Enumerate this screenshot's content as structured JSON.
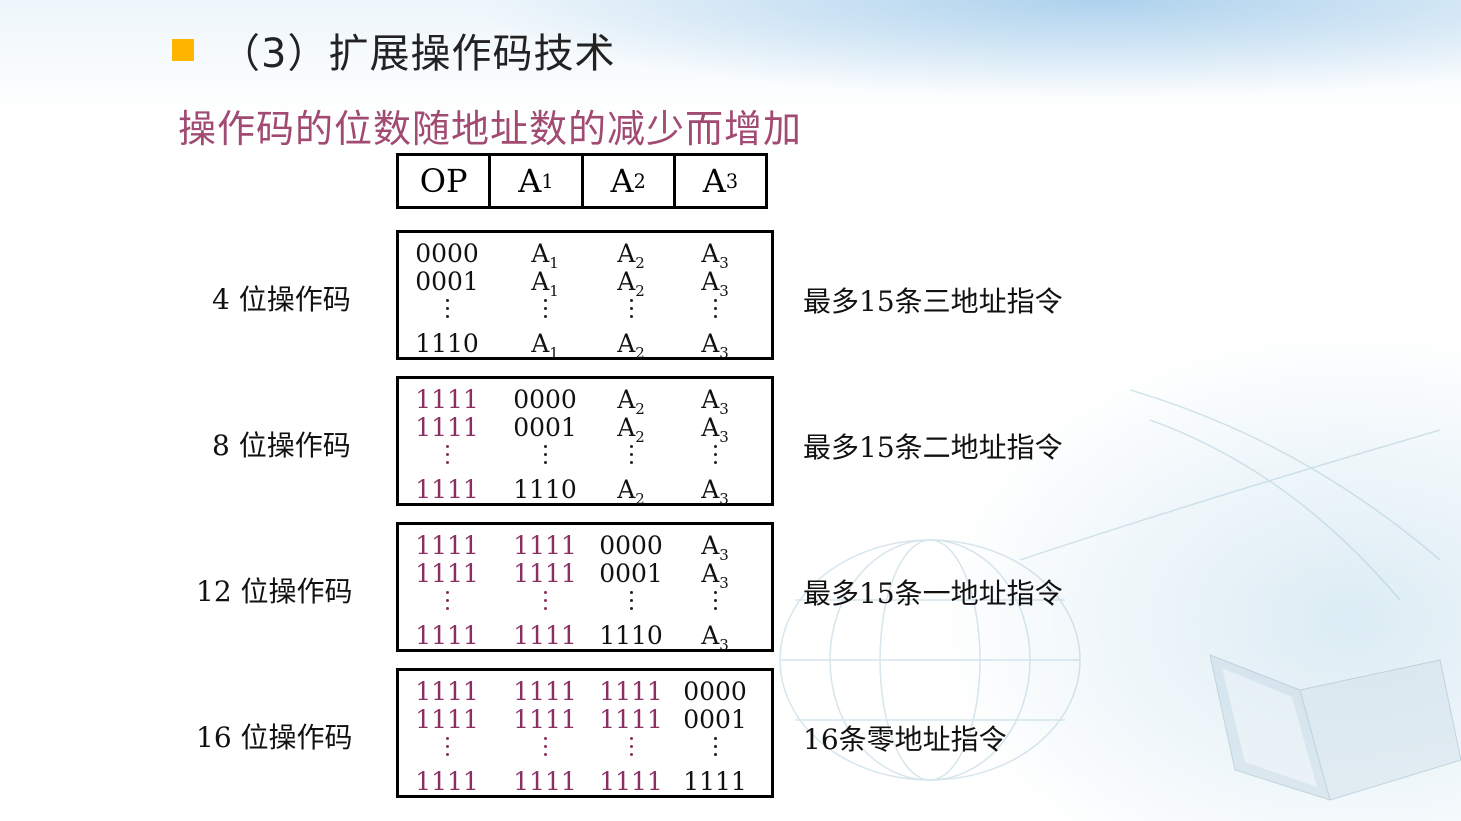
{
  "slide": {
    "title": "（3）扩展操作码技术",
    "subtitle": "操作码的位数随地址数的减少而增加"
  },
  "header": [
    {
      "main": "OP",
      "sub": ""
    },
    {
      "main": "A",
      "sub": "1"
    },
    {
      "main": "A",
      "sub": "2"
    },
    {
      "main": "A",
      "sub": "3"
    }
  ],
  "blocks": [
    {
      "label": "4 位操作码",
      "description": "最多15条三地址指令",
      "rows": [
        [
          "0000",
          "A1",
          "A2",
          "A3"
        ],
        [
          "0001",
          "A1",
          "A2",
          "A3"
        ],
        [
          "1110",
          "A1",
          "A2",
          "A3"
        ]
      ]
    },
    {
      "label": "8 位操作码",
      "description": "最多15条二地址指令",
      "rows": [
        [
          "1111",
          "0000",
          "A2",
          "A3"
        ],
        [
          "1111",
          "0001",
          "A2",
          "A3"
        ],
        [
          "1111",
          "1110",
          "A2",
          "A3"
        ]
      ]
    },
    {
      "label": "12 位操作码",
      "description": "最多15条一地址指令",
      "rows": [
        [
          "1111",
          "1111",
          "0000",
          "A3"
        ],
        [
          "1111",
          "1111",
          "0001",
          "A3"
        ],
        [
          "1111",
          "1111",
          "1110",
          "A3"
        ]
      ]
    },
    {
      "label": "16 位操作码",
      "description": "16条零地址指令",
      "rows": [
        [
          "1111",
          "1111",
          "1111",
          "0000"
        ],
        [
          "1111",
          "1111",
          "1111",
          "0001"
        ],
        [
          "1111",
          "1111",
          "1111",
          "1111"
        ]
      ]
    }
  ],
  "colors": {
    "accent_bullet": "#ffb400",
    "subtitle": "#a14a72",
    "extended_bits": "#8a2f62"
  }
}
